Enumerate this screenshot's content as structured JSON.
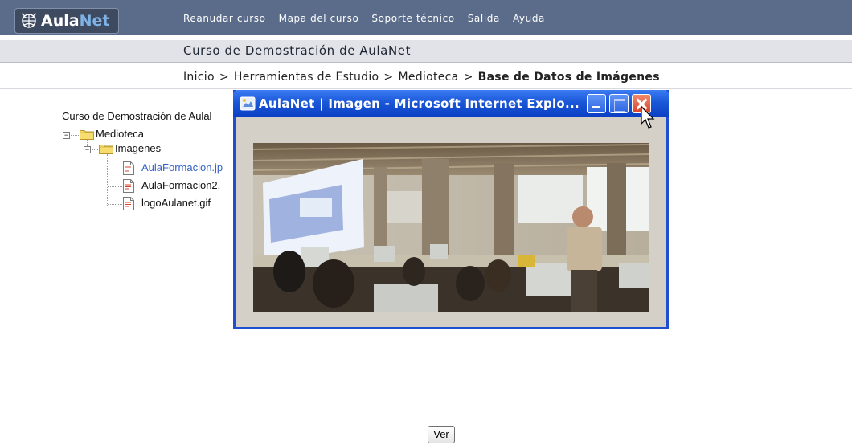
{
  "header": {
    "logo": {
      "part1": "Aula",
      "part2": "Net"
    },
    "nav": [
      "Reanudar curso",
      "Mapa del curso",
      "Soporte técnico",
      "Salida",
      "Ayuda"
    ]
  },
  "course": {
    "title": "Curso de Demostración de AulaNet"
  },
  "breadcrumb": {
    "items": [
      "Inicio",
      "Herramientas de Estudio",
      "Medioteca"
    ],
    "separator": ">",
    "current": "Base de Datos de Imágenes"
  },
  "tree": {
    "root": "Curso de Demostración de Aulal",
    "folder1": "Medioteca",
    "folder2": "Imagenes",
    "files": [
      "AulaFormacion.jp",
      "AulaFormacion2.",
      "logoAulanet.gif"
    ]
  },
  "popup": {
    "title": "AulaNet | Imagen - Microsoft Internet Explo..."
  },
  "buttons": {
    "ver": "Ver"
  },
  "colors": {
    "nav_bar": "#5b6c8b",
    "course_bar": "#e1e3e8",
    "xp_title_blue": "#1a57d8",
    "link_blue": "#3563c4"
  }
}
